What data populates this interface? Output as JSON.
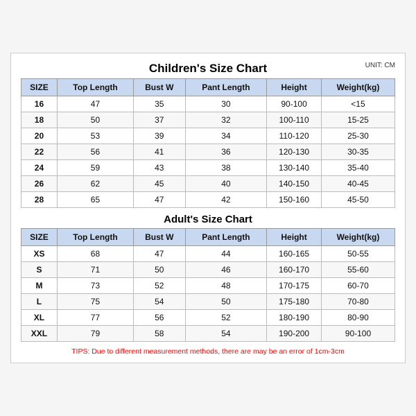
{
  "mainTitle": "Children's Size Chart",
  "unitLabel": "UNIT: CM",
  "childrenHeaders": [
    "SIZE",
    "Top Length",
    "Bust W",
    "Pant Length",
    "Height",
    "Weight(kg)"
  ],
  "childrenRows": [
    [
      "16",
      "47",
      "35",
      "30",
      "90-100",
      "<15"
    ],
    [
      "18",
      "50",
      "37",
      "32",
      "100-110",
      "15-25"
    ],
    [
      "20",
      "53",
      "39",
      "34",
      "110-120",
      "25-30"
    ],
    [
      "22",
      "56",
      "41",
      "36",
      "120-130",
      "30-35"
    ],
    [
      "24",
      "59",
      "43",
      "38",
      "130-140",
      "35-40"
    ],
    [
      "26",
      "62",
      "45",
      "40",
      "140-150",
      "40-45"
    ],
    [
      "28",
      "65",
      "47",
      "42",
      "150-160",
      "45-50"
    ]
  ],
  "adultTitle": "Adult's Size Chart",
  "adultHeaders": [
    "SIZE",
    "Top Length",
    "Bust W",
    "Pant Length",
    "Height",
    "Weight(kg)"
  ],
  "adultRows": [
    [
      "XS",
      "68",
      "47",
      "44",
      "160-165",
      "50-55"
    ],
    [
      "S",
      "71",
      "50",
      "46",
      "160-170",
      "55-60"
    ],
    [
      "M",
      "73",
      "52",
      "48",
      "170-175",
      "60-70"
    ],
    [
      "L",
      "75",
      "54",
      "50",
      "175-180",
      "70-80"
    ],
    [
      "XL",
      "77",
      "56",
      "52",
      "180-190",
      "80-90"
    ],
    [
      "XXL",
      "79",
      "58",
      "54",
      "190-200",
      "90-100"
    ]
  ],
  "tips": "TIPS: Due to different measurement methods, there are may be an error of 1cm-3cm"
}
